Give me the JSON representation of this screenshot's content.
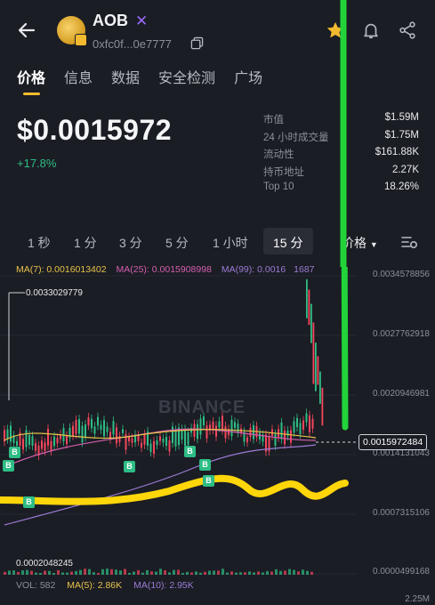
{
  "token": {
    "name": "AOB",
    "address": "0xfc0f...0e7777"
  },
  "tabs": [
    "价格",
    "信息",
    "数据",
    "安全检测",
    "广场"
  ],
  "price": "$0.0015972",
  "change": "+17.8%",
  "stats": [
    {
      "label": "市值",
      "value": "$1.59M"
    },
    {
      "label": "24 小时成交量",
      "value": "$1.75M"
    },
    {
      "label": "流动性",
      "value": "$161.88K"
    },
    {
      "label": "持币地址",
      "value": "2.27K"
    },
    {
      "label": "Top 10",
      "value": "18.26%"
    }
  ],
  "intervals": [
    "1 秒",
    "1 分",
    "3 分",
    "5 分",
    "1 小时",
    "15 分"
  ],
  "price_menu": "价格",
  "ma": {
    "ma7": "MA(7): 0.0016013402",
    "ma25": "MA(25): 0.0015908998",
    "ma99": "MA(99): 0.0016"
  },
  "chart": {
    "axis_labels": [
      "0.0034578856",
      "0.0027762918",
      "0.0020946981",
      "0.0014131043",
      "0.0007315106",
      "0.0000499168"
    ],
    "current_price": "0.0015972484",
    "high_label": "0.0033029779",
    "low_label": "0.0002048245",
    "watermark": "BINANCE",
    "buy_marker": "B",
    "ma_partial": "1687"
  },
  "volume": {
    "label": "VOL: 582",
    "ma5": "MA(5): 2.86K",
    "ma10": "MA(10): 2.95K",
    "axis": "2.25M"
  },
  "colors": {
    "up": "#2ebd85",
    "down": "#f6465d",
    "accent": "#f3ba2f",
    "highlight_green": "#22d33a",
    "highlight_yellow": "#ffd60a"
  }
}
